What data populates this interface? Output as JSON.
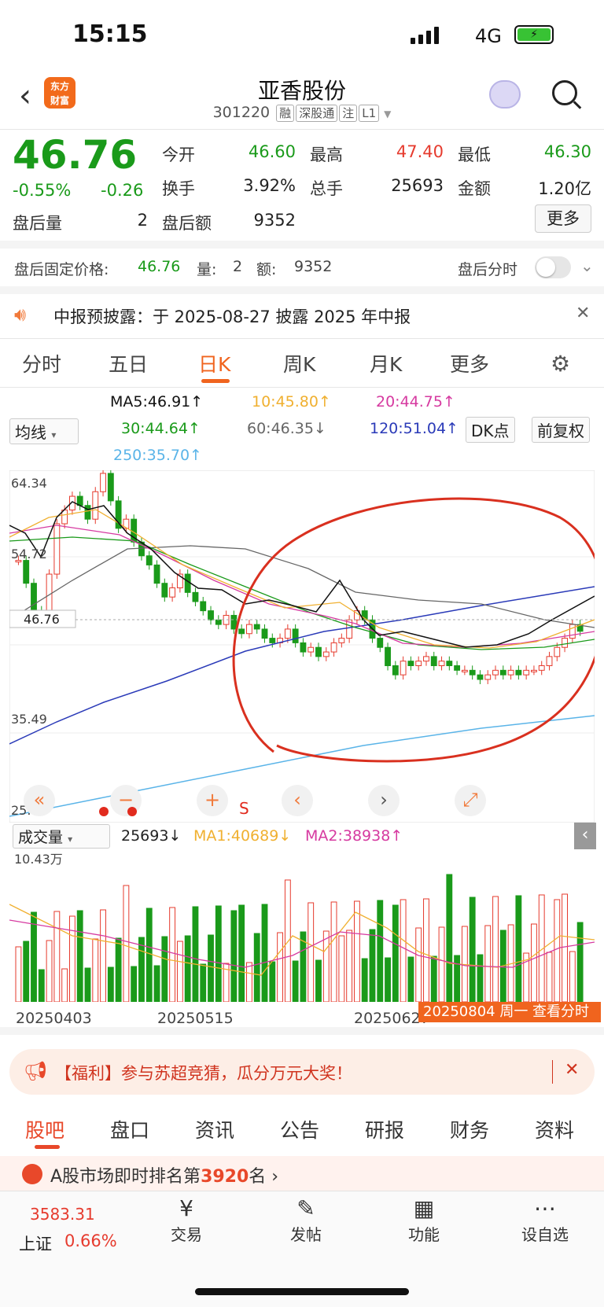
{
  "status_bar": {
    "time": "15:15",
    "network": "4G"
  },
  "header": {
    "title": "亚香股份",
    "code": "301220",
    "tags": [
      "融",
      "深股通",
      "注",
      "L1"
    ],
    "brand": "东方\n财富"
  },
  "quote": {
    "price": "46.76",
    "change_pct": "-0.55%",
    "change": "-0.26",
    "after_vol_label": "盘后量",
    "after_vol": "2",
    "open_label": "今开",
    "open": "46.60",
    "high_label": "最高",
    "high": "47.40",
    "low_label": "最低",
    "low": "46.30",
    "turnover_label": "换手",
    "turnover": "3.92%",
    "volume_label": "总手",
    "volume": "25693",
    "amount_label": "金额",
    "amount": "1.20亿",
    "after_amt_label": "盘后额",
    "after_amt": "9352",
    "more_button": "更多"
  },
  "after_hours": {
    "label": "盘后固定价格:",
    "price": "46.76",
    "vol_label": "量:",
    "vol": "2",
    "amt_label": "额:",
    "amt": "9352",
    "toggle_label": "盘后分时"
  },
  "notice": {
    "text": "中报预披露：于 2025-08-27 披露 2025 年中报"
  },
  "tabs": [
    "分时",
    "五日",
    "日K",
    "周K",
    "月K",
    "更多"
  ],
  "active_tab": "日K",
  "ma": {
    "selector": "均线",
    "ma5": "MA5:46.91↑",
    "ma10": "10:45.80↑",
    "ma20": "20:44.75↑",
    "ma30": "30:44.64↑",
    "ma60": "60:46.35↓",
    "ma120": "120:51.04↑",
    "ma250": "250:35.70↑",
    "dk_button": "DK点",
    "adjust_button": "前复权"
  },
  "chart_axis": {
    "y_top": "64.34",
    "y_mid1": "54.72",
    "y_cur": "46.76",
    "y_mid2": "35.49",
    "y_bottom": "25.87"
  },
  "volume_panel": {
    "selector": "成交量",
    "vol": "25693↓",
    "ma1": "MA1:40689↓",
    "ma2": "MA2:38938↑",
    "max": "10.43万"
  },
  "dates": [
    "20250403",
    "20250515",
    "20250627",
    "20250804"
  ],
  "date_tip": "20250804 周一 查看分时",
  "controls": {
    "rewind": "«",
    "minus": "−",
    "plus": "+",
    "s_mark": "S",
    "prev": "‹",
    "next": "›",
    "expand": "⤢"
  },
  "promo": {
    "text": "【福利】参与苏超竞猜，瓜分万元大奖！"
  },
  "bottom_tabs": [
    "股吧",
    "盘口",
    "资讯",
    "公告",
    "研报",
    "财务",
    "资料"
  ],
  "rank": {
    "prefix": "A股市场即时排名第",
    "num": "3920",
    "suffix": "名"
  },
  "nav": {
    "index_value": "3583.31",
    "index_name": "上证",
    "index_pct": "0.66%",
    "trade": "交易",
    "post": "发帖",
    "func": "功能",
    "watch": "设自选"
  },
  "chart_data": {
    "type": "candlestick",
    "ylim": [
      25.87,
      64.34
    ],
    "dates_shown": [
      "20250403",
      "20250515",
      "20250627",
      "20250804"
    ],
    "close": [
      54.5,
      52.0,
      49.0,
      48.5,
      53.0,
      58.5,
      60.0,
      61.5,
      60.5,
      59.0,
      62.0,
      64.0,
      61.0,
      58.0,
      59.0,
      56.5,
      55.0,
      54.0,
      52.0,
      50.5,
      51.5,
      53.0,
      51.0,
      50.0,
      49.0,
      48.0,
      47.5,
      48.5,
      47.0,
      46.5,
      47.5,
      47.0,
      46.0,
      45.5,
      46.0,
      47.0,
      45.5,
      44.5,
      45.0,
      44.0,
      44.5,
      45.5,
      46.0,
      48.0,
      49.0,
      48.0,
      46.0,
      45.0,
      43.0,
      42.0,
      43.5,
      43.0,
      43.5,
      44.0,
      43.0,
      43.5,
      43.0,
      42.5,
      42.5,
      42.0,
      41.5,
      42.0,
      42.5,
      42.0,
      42.5,
      42.0,
      42.5,
      42.5,
      43.0,
      44.0,
      45.0,
      46.0,
      47.5,
      46.76
    ],
    "volume_max_label": "10.43万"
  }
}
